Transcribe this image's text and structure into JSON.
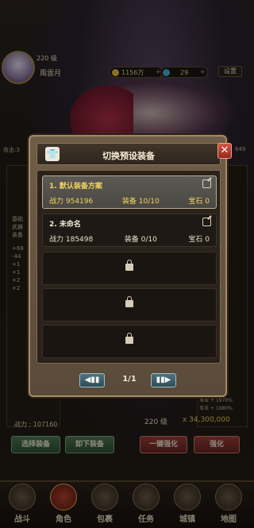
{
  "player": {
    "level": "220 级",
    "name": "風雲月"
  },
  "currency": {
    "gold": "1156万",
    "gems": "29",
    "plus": "+"
  },
  "settings_label": "设置",
  "attack_left": "攻击:3",
  "attack_right": "649",
  "left_panel": {
    "lines": [
      "基础",
      "武器",
      "装备",
      "+68",
      "-44",
      "+1",
      "+1",
      "+2",
      "+2"
    ]
  },
  "right_panel": {
    "lines": [
      "攻击 + 1970%",
      "攻击 + 1980%"
    ]
  },
  "power_bottom": "战力 : 107160",
  "buttons": {
    "select_equip": "选择装备",
    "unequip": "卸下装备",
    "one_key_enhance": "一键强化",
    "enhance": "强化"
  },
  "level_bottom": "220 级",
  "gold_bottom": "x 34,300,000",
  "nav": [
    {
      "label": "战斗"
    },
    {
      "label": "角色"
    },
    {
      "label": "包裹"
    },
    {
      "label": "任务"
    },
    {
      "label": "城镇"
    },
    {
      "label": "地图"
    }
  ],
  "modal": {
    "title": "切换预设装备",
    "close": "✕",
    "presets": [
      {
        "name": "1. 默认装备方案",
        "power": "战力 954196",
        "equip": "装备 10/10",
        "gems": "宝石 0"
      },
      {
        "name": "2. 未命名",
        "power": "战力 185498",
        "equip": "装备 0/10",
        "gems": "宝石 0"
      }
    ],
    "page": "1/1"
  },
  "colors": {
    "selected_text": "#f2d45a",
    "accent_red": "#c0392b",
    "green_btn": "#3e6a46"
  }
}
